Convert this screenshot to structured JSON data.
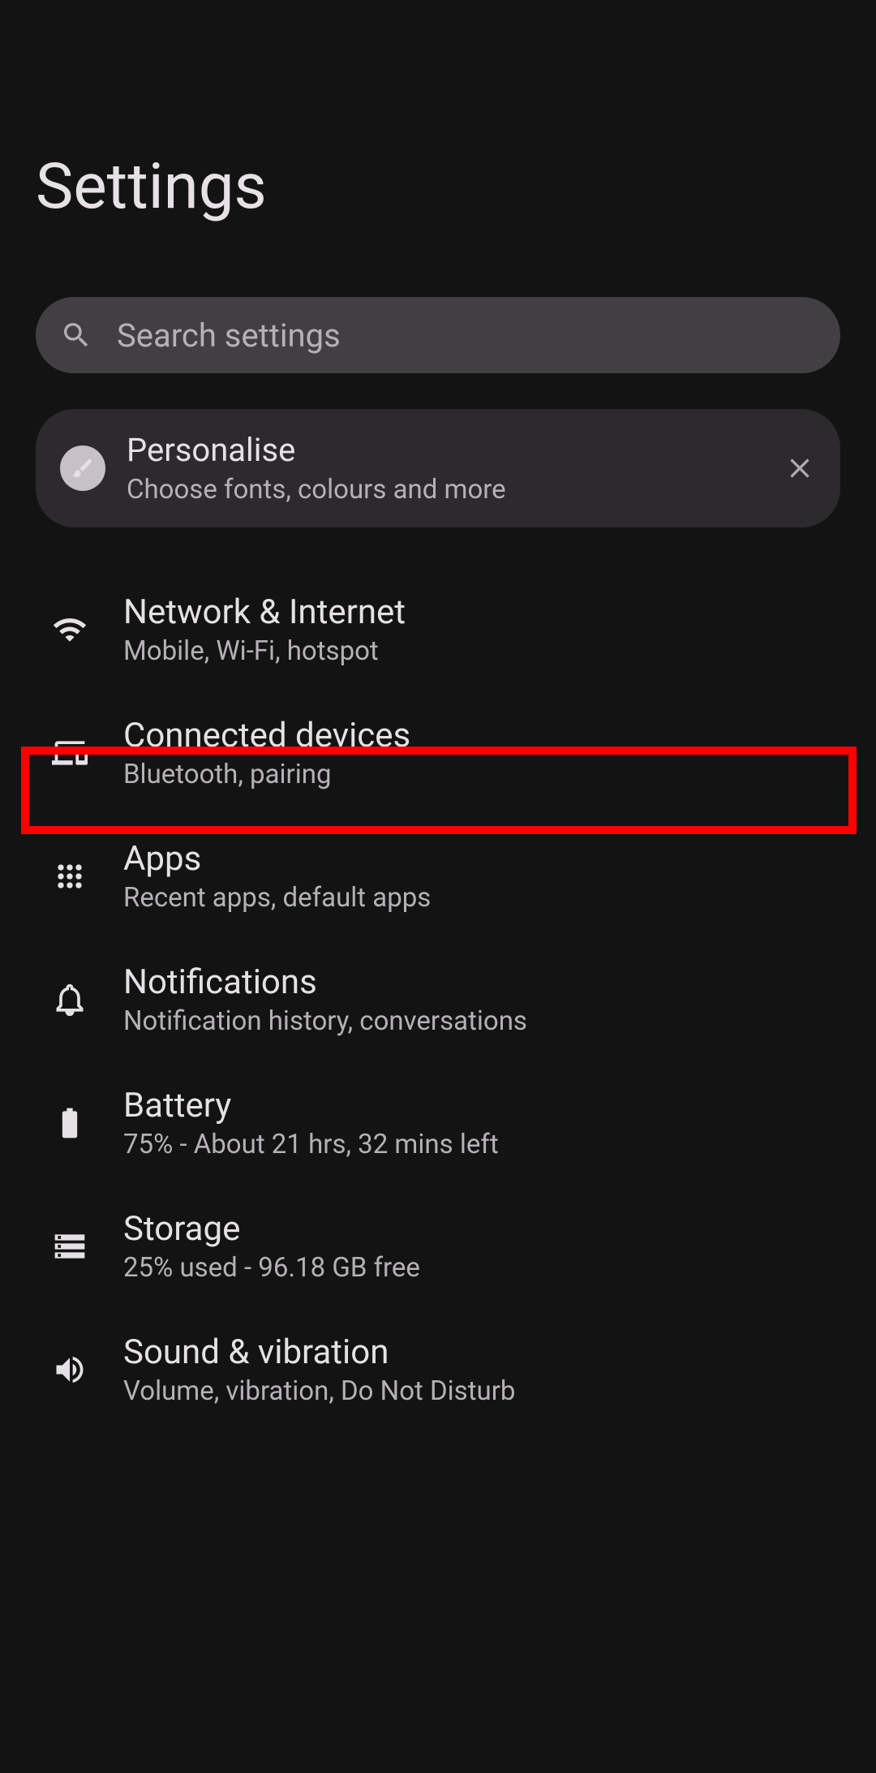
{
  "title": "Settings",
  "search": {
    "placeholder": "Search settings"
  },
  "personalise": {
    "title": "Personalise",
    "subtitle": "Choose fonts, colours and more"
  },
  "items": [
    {
      "title": "Network & Internet",
      "subtitle": "Mobile, Wi-Fi, hotspot"
    },
    {
      "title": "Connected devices",
      "subtitle": "Bluetooth, pairing"
    },
    {
      "title": "Apps",
      "subtitle": "Recent apps, default apps"
    },
    {
      "title": "Notifications",
      "subtitle": "Notification history, conversations"
    },
    {
      "title": "Battery",
      "subtitle": "75% - About 21 hrs, 32 mins left"
    },
    {
      "title": "Storage",
      "subtitle": "25% used - 96.18 GB free"
    },
    {
      "title": "Sound & vibration",
      "subtitle": "Volume, vibration, Do Not Disturb"
    }
  ]
}
